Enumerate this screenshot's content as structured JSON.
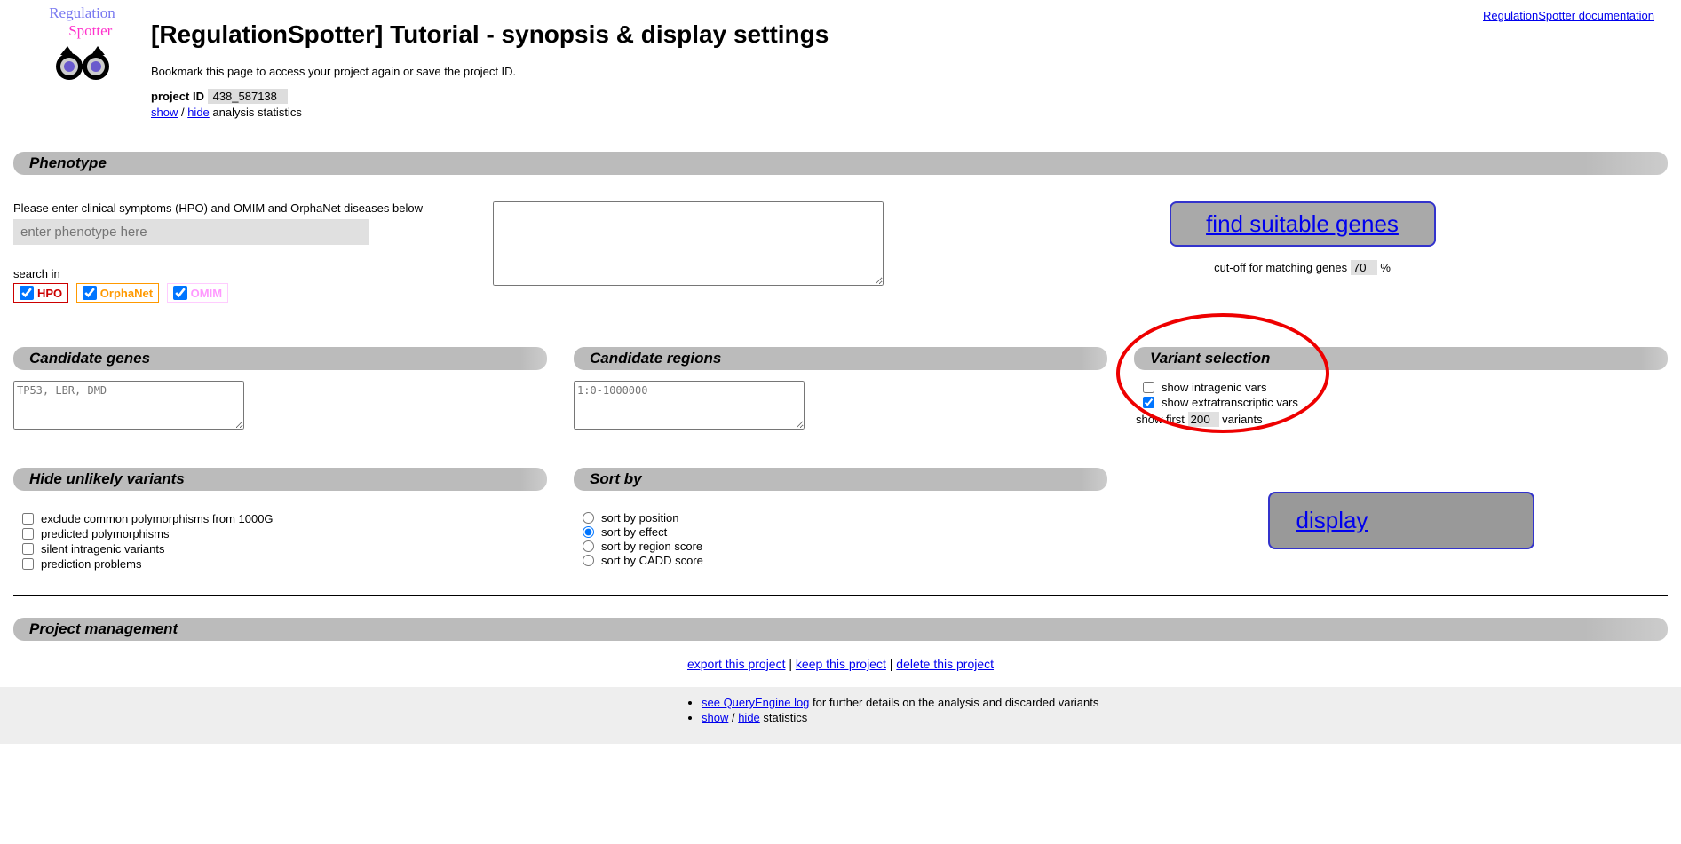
{
  "doc_link": "RegulationSpotter documentation",
  "logo": {
    "regulation": "Regulation",
    "spotter": "Spotter"
  },
  "title": "[RegulationSpotter] Tutorial - synopsis & display settings",
  "subtitle": "Bookmark this page to access your project again or save the project ID.",
  "project_id_label": "project ID",
  "project_id": "438_587138",
  "show_link": "show",
  "hide_link": "hide",
  "analysis_stats_suffix": " analysis statistics",
  "sections": {
    "phenotype": "Phenotype",
    "candidate_genes": "Candidate genes",
    "candidate_regions": "Candidate regions",
    "variant_selection": "Variant selection",
    "hide_unlikely": "Hide unlikely variants",
    "sort_by": "Sort by",
    "project_mgmt": "Project management"
  },
  "phenotype": {
    "prompt": "Please enter clinical symptoms (HPO) and OMIM and OrphaNet diseases below",
    "placeholder": "enter phenotype here",
    "search_in_label": "search in",
    "hpo": "HPO",
    "orphanet": "OrphaNet",
    "omim": "OMIM",
    "find_genes_btn": "find suitable genes",
    "cutoff_label": "cut-off for matching genes ",
    "cutoff_value": "70",
    "cutoff_suffix": " %"
  },
  "candidate_genes": {
    "placeholder": "TP53, LBR, DMD"
  },
  "candidate_regions": {
    "placeholder": "1:0-1000000"
  },
  "variant_selection": {
    "intragenic": "show intragenic vars",
    "extratranscriptic": "show extratranscriptic vars",
    "show_first_prefix": "show first ",
    "show_first_value": "200",
    "show_first_suffix": " variants"
  },
  "hide_unlikely": {
    "opt1": "exclude common polymorphisms from 1000G",
    "opt2": "predicted polymorphisms",
    "opt3": "silent intragenic variants",
    "opt4": "prediction problems"
  },
  "sort_by": {
    "opt1": "sort by position",
    "opt2": "sort by effect",
    "opt3": "sort by region score",
    "opt4": "sort by CADD score"
  },
  "display_btn": "display",
  "pm_links": {
    "export": "export this project",
    "keep": "keep this project",
    "delete": "delete this project",
    "sep": " | "
  },
  "footer": {
    "qe_link": "see QueryEngine log",
    "qe_suffix": " for further details on the analysis and discarded variants",
    "show": "show",
    "hide": "hide",
    "stats_suffix": " statistics"
  }
}
